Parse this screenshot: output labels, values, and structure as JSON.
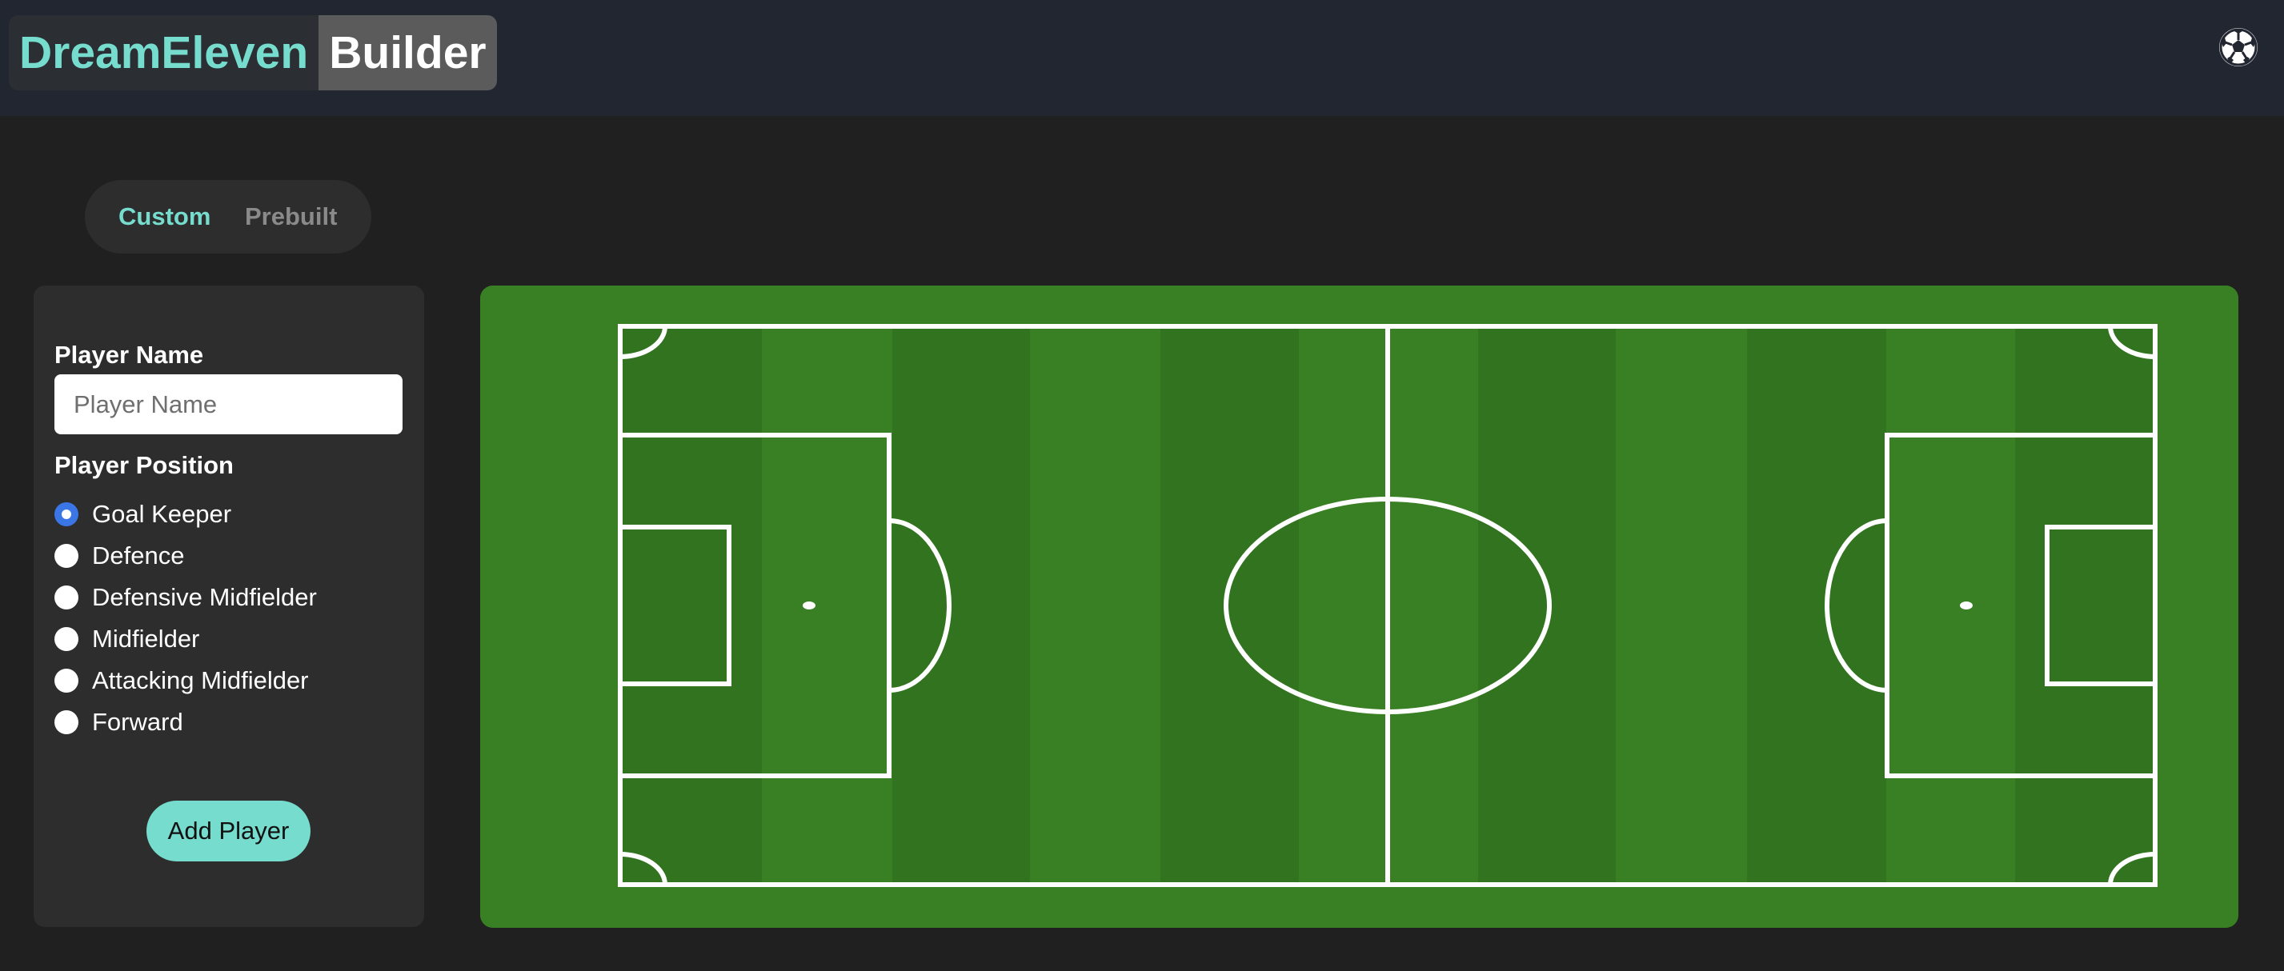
{
  "header": {
    "logo_part1": "DreamEleven",
    "logo_part2": "Builder",
    "icon": "soccer-ball-icon"
  },
  "mode_toggle": {
    "options": [
      "Custom",
      "Prebuilt"
    ],
    "selected": "Custom"
  },
  "form": {
    "name_label": "Player Name",
    "name_placeholder": "Player Name",
    "name_value": "",
    "position_label": "Player Position",
    "positions": [
      {
        "label": "Goal Keeper",
        "checked": true
      },
      {
        "label": "Defence",
        "checked": false
      },
      {
        "label": "Defensive Midfielder",
        "checked": false
      },
      {
        "label": "Midfielder",
        "checked": false
      },
      {
        "label": "Attacking Midfielder",
        "checked": false
      },
      {
        "label": "Forward",
        "checked": false
      }
    ],
    "add_button": "Add Player"
  },
  "colors": {
    "accent": "#76dccd",
    "header_bg": "#222631",
    "page_bg": "#202020",
    "panel_bg": "#2d2d2d",
    "pitch_light": "#397f23",
    "pitch_dark": "#327320",
    "radio_selected": "#3a76e6",
    "pitch_lines": "#ffffff"
  }
}
